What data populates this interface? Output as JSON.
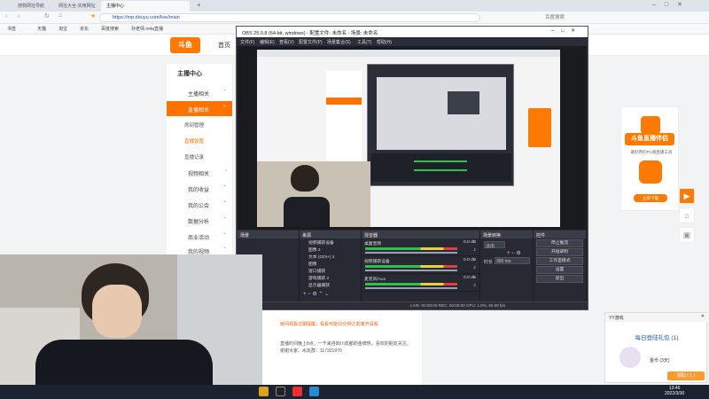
{
  "browser": {
    "tabs": [
      {
        "label": "搜狗网址导航"
      },
      {
        "label": "网址大全-实用网址"
      },
      {
        "label": "主播中心"
      }
    ],
    "url": "https://mp.douyu.com/live/main",
    "search_placeholder": "百度搜索",
    "bookmarks": [
      "书签",
      "天猫",
      "淘宝",
      "京东",
      "百度搜索",
      "孙老师.m4a直播"
    ]
  },
  "site": {
    "logo_text": "斗鱼",
    "page_title": "首页",
    "sidebar_title": "主播中心",
    "sidebar": [
      {
        "label": "主播相关",
        "active": false
      },
      {
        "label": "直播相关",
        "active": true
      },
      {
        "label": "房间管理",
        "sub": true,
        "active": false
      },
      {
        "label": "直播设置",
        "sub": true,
        "active": true
      },
      {
        "label": "直播记录",
        "sub": true,
        "active": false
      },
      {
        "label": "视频相关",
        "active": false
      },
      {
        "label": "我的收益",
        "active": false
      },
      {
        "label": "我的公会",
        "active": false
      },
      {
        "label": "数据分析",
        "active": false
      },
      {
        "label": "商业活动",
        "active": false
      },
      {
        "label": "我的视频",
        "active": false
      }
    ],
    "chat_line1": "房间观看过期提醒，看看可能10分钟之前离开请看",
    "chat_line2": "直播时间晚上8点，一千来自四川成都的金牌热，喜欢的朋友关注，谢谢大家。水友群：117331970",
    "ad_title": "斗鱼直播伴侣",
    "ad_sub": "最好用的PC端直播工具",
    "ad_button": "立即下载"
  },
  "obs": {
    "title": "OBS 25.0.8 (64-bit, windows) - 配置文件: 未命名 - 场景: 未命名",
    "menu": [
      "文件(F)",
      "编辑(E)",
      "查看(V)",
      "配置文件(P)",
      "场景集合(S)",
      "工具(T)",
      "帮助(H)"
    ],
    "dock_titles": {
      "scenes": "场景",
      "sources": "来源",
      "mixer": "混音器",
      "transitions": "场景转换",
      "controls": "控件"
    },
    "sources": [
      "视频捕获设备",
      "图像 2",
      "文本 (GDI+) 2",
      "图像",
      "窗口捕获",
      "游戏捕获 2",
      "显示器捕获"
    ],
    "mixer": [
      {
        "name": "桌面音频",
        "db": "0.0 dB"
      },
      {
        "name": "视频捕获设备",
        "db": "0.0 dB"
      },
      {
        "name": "麦克风/Aux",
        "db": "0.0 dB"
      }
    ],
    "transition": {
      "type": "淡出",
      "duration_label": "时长",
      "duration": "300 ms"
    },
    "controls": [
      "停止推流",
      "开始录制",
      "工作室模式",
      "设置",
      "退出"
    ],
    "status": "LIVE: 00:00:00   REC: 00:00:00   CPU: 1.9%, 60.00 fps"
  },
  "popup": {
    "header": "YY游戏",
    "title": "每日登陆礼包 (1)",
    "desc": "金币 (3天)",
    "button": "领取 ( 1 )"
  },
  "taskbar": {
    "time": "13:46",
    "date": "2022/3/30"
  },
  "colors": {
    "accent": "#ff7200",
    "obs_bg": "#2b2e38"
  }
}
